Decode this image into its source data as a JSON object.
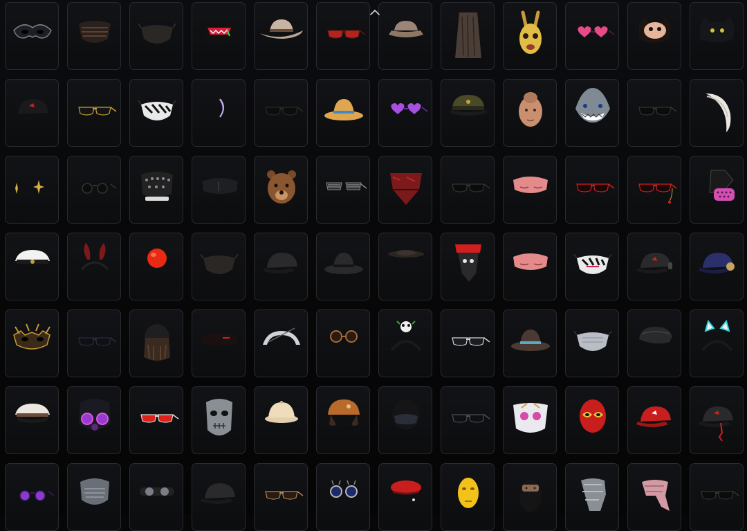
{
  "icons": {
    "scroll": "chevron-up-icon"
  },
  "palette": {
    "tile_border": "#2a2b2f",
    "tile_bg": "#0e0f11",
    "accent_red": "#d11f1f"
  },
  "items": [
    [
      "masquerade-mask",
      "dark-tactical-mask",
      "black-face-mask",
      "red-demon-mask",
      "cowboy-hat",
      "red-sunglasses",
      "bucket-hat",
      "ragged-hood",
      "bunny-mask",
      "pink-heart-glasses",
      "cat-mask",
      "black-cat-hood"
    ],
    [
      "red-cap",
      "gold-rim-glasses",
      "zebra-mask",
      "purple-crescent-earring",
      "black-narrow-glasses",
      "straw-hat",
      "purple-heart-glasses",
      "military-cap",
      "bald-head-mask",
      "shark-mask",
      "black-sunglasses",
      "white-fur-collar"
    ],
    [
      "gold-star-earrings",
      "black-round-glasses",
      "studded-mask",
      "black-eyepatch-visor",
      "bear-mask",
      "shutter-shades",
      "red-bandana",
      "black-sunglasses",
      "pink-sleep-mask",
      "red-cat-eye-glasses",
      "red-glasses-chain",
      "pink-gas-mask"
    ],
    [
      "white-captain-hat",
      "red-bunny-ears-headband",
      "red-clown-nose",
      "black-face-mask",
      "black-baseball-cap",
      "black-fedora",
      "black-flat-hat",
      "red-skull-bandana",
      "pink-sleep-mask",
      "zebra-face-mask",
      "black-headphone-cap",
      "navy-cap-headphones"
    ],
    [
      "gold-spiked-mask",
      "black-sport-glasses",
      "aviator-helmet",
      "black-visor-glasses",
      "white-sport-mask",
      "steampunk-goggles",
      "panda-headband",
      "silver-sport-glasses",
      "brown-fedora",
      "silver-face-mask",
      "black-flat-cap",
      "neon-cat-ears-headband"
    ],
    [
      "white-navy-cap",
      "neon-gas-mask",
      "red-sport-glasses",
      "silver-skull-mask",
      "pith-helmet",
      "brown-aviator-cap",
      "black-helmet",
      "black-wraparound-glasses",
      "white-pink-mask",
      "lucha-libre-mask",
      "red-baseball-cap",
      "black-red-cap"
    ],
    [
      "purple-round-glasses",
      "grey-respirator",
      "black-goggles",
      "black-baseball-cap",
      "brown-sport-glasses",
      "blue-steampunk-goggles",
      "red-beret",
      "yellow-face-mask",
      "black-balaclava",
      "grey-scarf",
      "pink-scarf",
      "black-sunglasses"
    ]
  ]
}
